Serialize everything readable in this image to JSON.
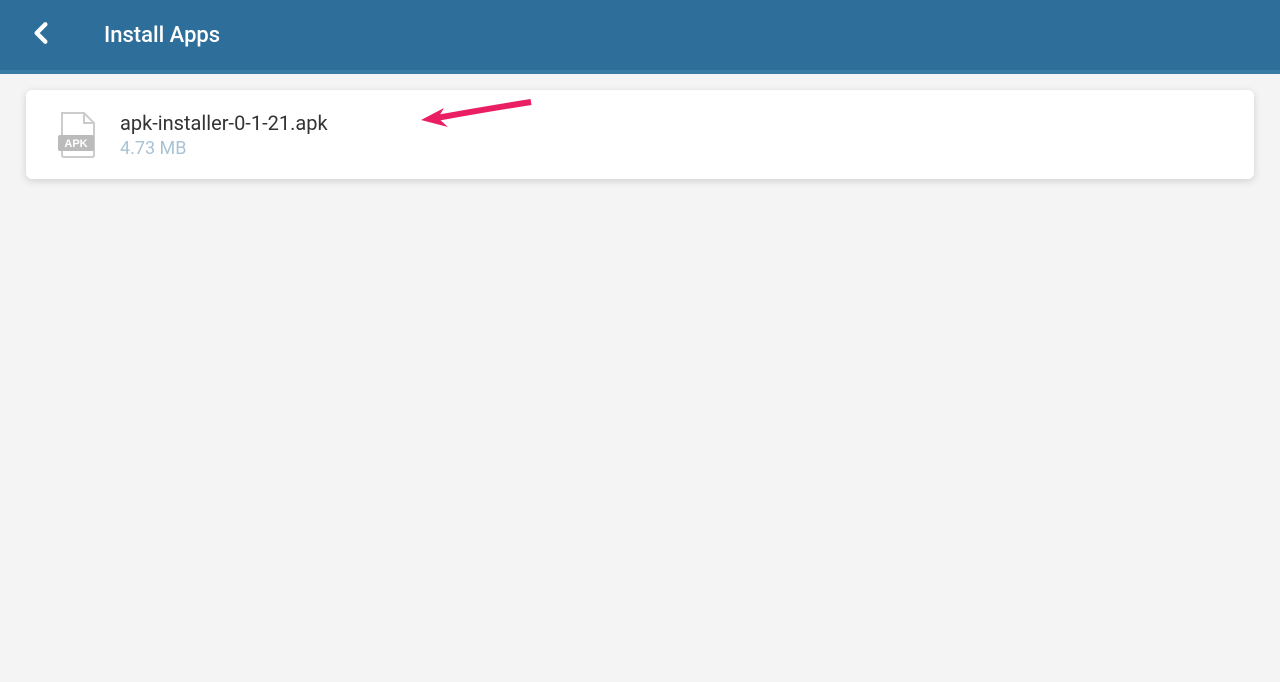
{
  "header": {
    "title": "Install Apps"
  },
  "files": [
    {
      "name": "apk-installer-0-1-21.apk",
      "size": "4.73 MB",
      "icon_label": "APK"
    }
  ]
}
